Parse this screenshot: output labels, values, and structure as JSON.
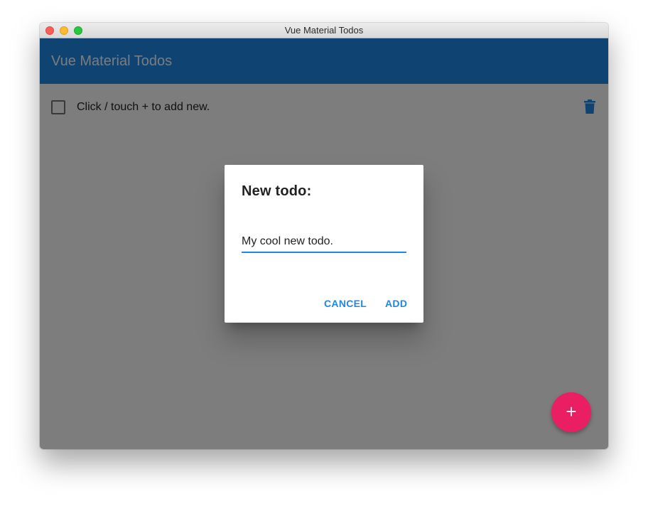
{
  "window": {
    "title": "Vue Material Todos"
  },
  "toolbar": {
    "title": "Vue Material Todos"
  },
  "todos": [
    {
      "text": "Click / touch + to add new.",
      "done": false
    }
  ],
  "dialog": {
    "title": "New todo:",
    "input_value": "My cool new todo.",
    "cancel_label": "CANCEL",
    "add_label": "ADD"
  },
  "fab": {
    "label": "+"
  },
  "icons": {
    "delete": "trash-icon",
    "add": "plus-icon"
  },
  "colors": {
    "primary": "#1e88e5",
    "accent": "#e91e63"
  }
}
